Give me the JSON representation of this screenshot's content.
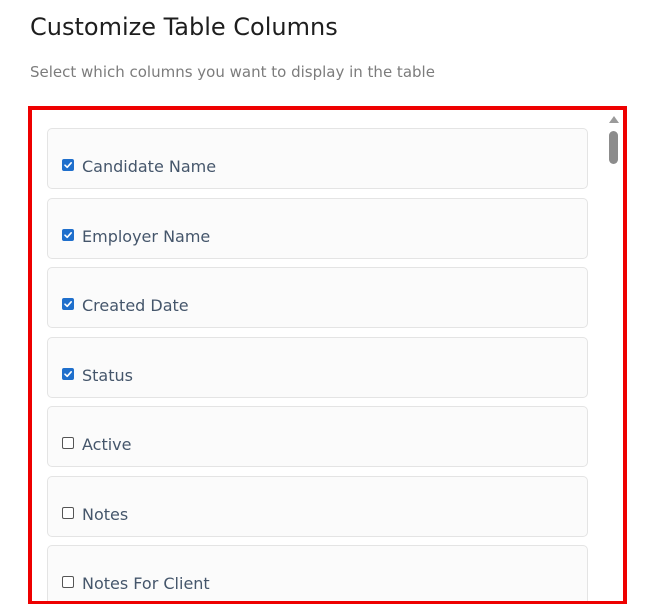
{
  "header": {
    "title": "Customize Table Columns",
    "subtitle": "Select which columns you want to display in the table"
  },
  "columns": [
    {
      "label": "Candidate Name",
      "checked": true
    },
    {
      "label": "Employer Name",
      "checked": true
    },
    {
      "label": "Created Date",
      "checked": true
    },
    {
      "label": "Status",
      "checked": true
    },
    {
      "label": "Active",
      "checked": false
    },
    {
      "label": "Notes",
      "checked": false
    },
    {
      "label": "Notes For Client",
      "checked": false
    }
  ],
  "colors": {
    "highlight_border": "#ee0000",
    "checkbox_accent": "#1f6fcc",
    "label_text": "#45566b"
  }
}
